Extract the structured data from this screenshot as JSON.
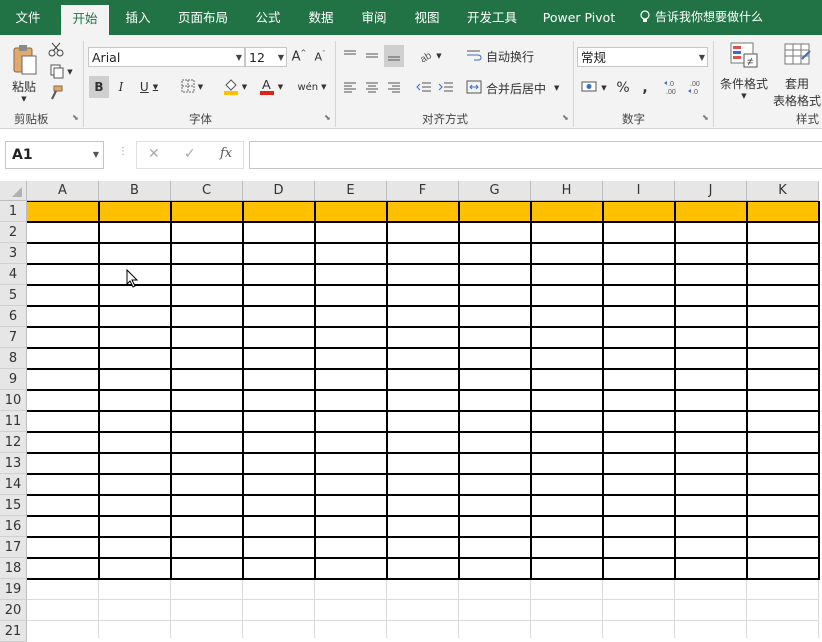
{
  "tabs": [
    "文件",
    "开始",
    "插入",
    "页面布局",
    "公式",
    "数据",
    "审阅",
    "视图",
    "开发工具",
    "Power Pivot"
  ],
  "active_tab": "开始",
  "tell_me": "告诉我你想要做什么",
  "ribbon": {
    "clipboard": {
      "paste_label": "粘贴",
      "group_label": "剪贴板"
    },
    "font": {
      "font_name": "Arial",
      "font_size": "12",
      "group_label": "字体",
      "bold": "B",
      "italic": "I",
      "underline": "U",
      "phonetic": "wén"
    },
    "alignment": {
      "wrap_text": "自动换行",
      "merge_center": "合并后居中",
      "group_label": "对齐方式"
    },
    "number": {
      "format": "常规",
      "percent": "%",
      "comma": ",",
      "group_label": "数字"
    },
    "styles": {
      "conditional_format": "条件格式",
      "table_format_line1": "套用",
      "table_format_line2": "表格格式",
      "group_label": "样式"
    }
  },
  "formula_bar": {
    "name_box": "A1",
    "fx": "fx",
    "content": ""
  },
  "columns": [
    "A",
    "B",
    "C",
    "D",
    "E",
    "F",
    "G",
    "H",
    "I",
    "J",
    "K"
  ],
  "rows": [
    "1",
    "2",
    "3",
    "4",
    "5",
    "6",
    "7",
    "8",
    "9",
    "10",
    "11",
    "12",
    "13",
    "14",
    "15",
    "16",
    "17",
    "18",
    "19",
    "20",
    "21"
  ],
  "colors": {
    "header_fill": "#FFC000",
    "excel_green": "#217346",
    "table_border": "#000000"
  },
  "table": {
    "header_row": 1,
    "last_row": 18,
    "columns": "A:K"
  }
}
